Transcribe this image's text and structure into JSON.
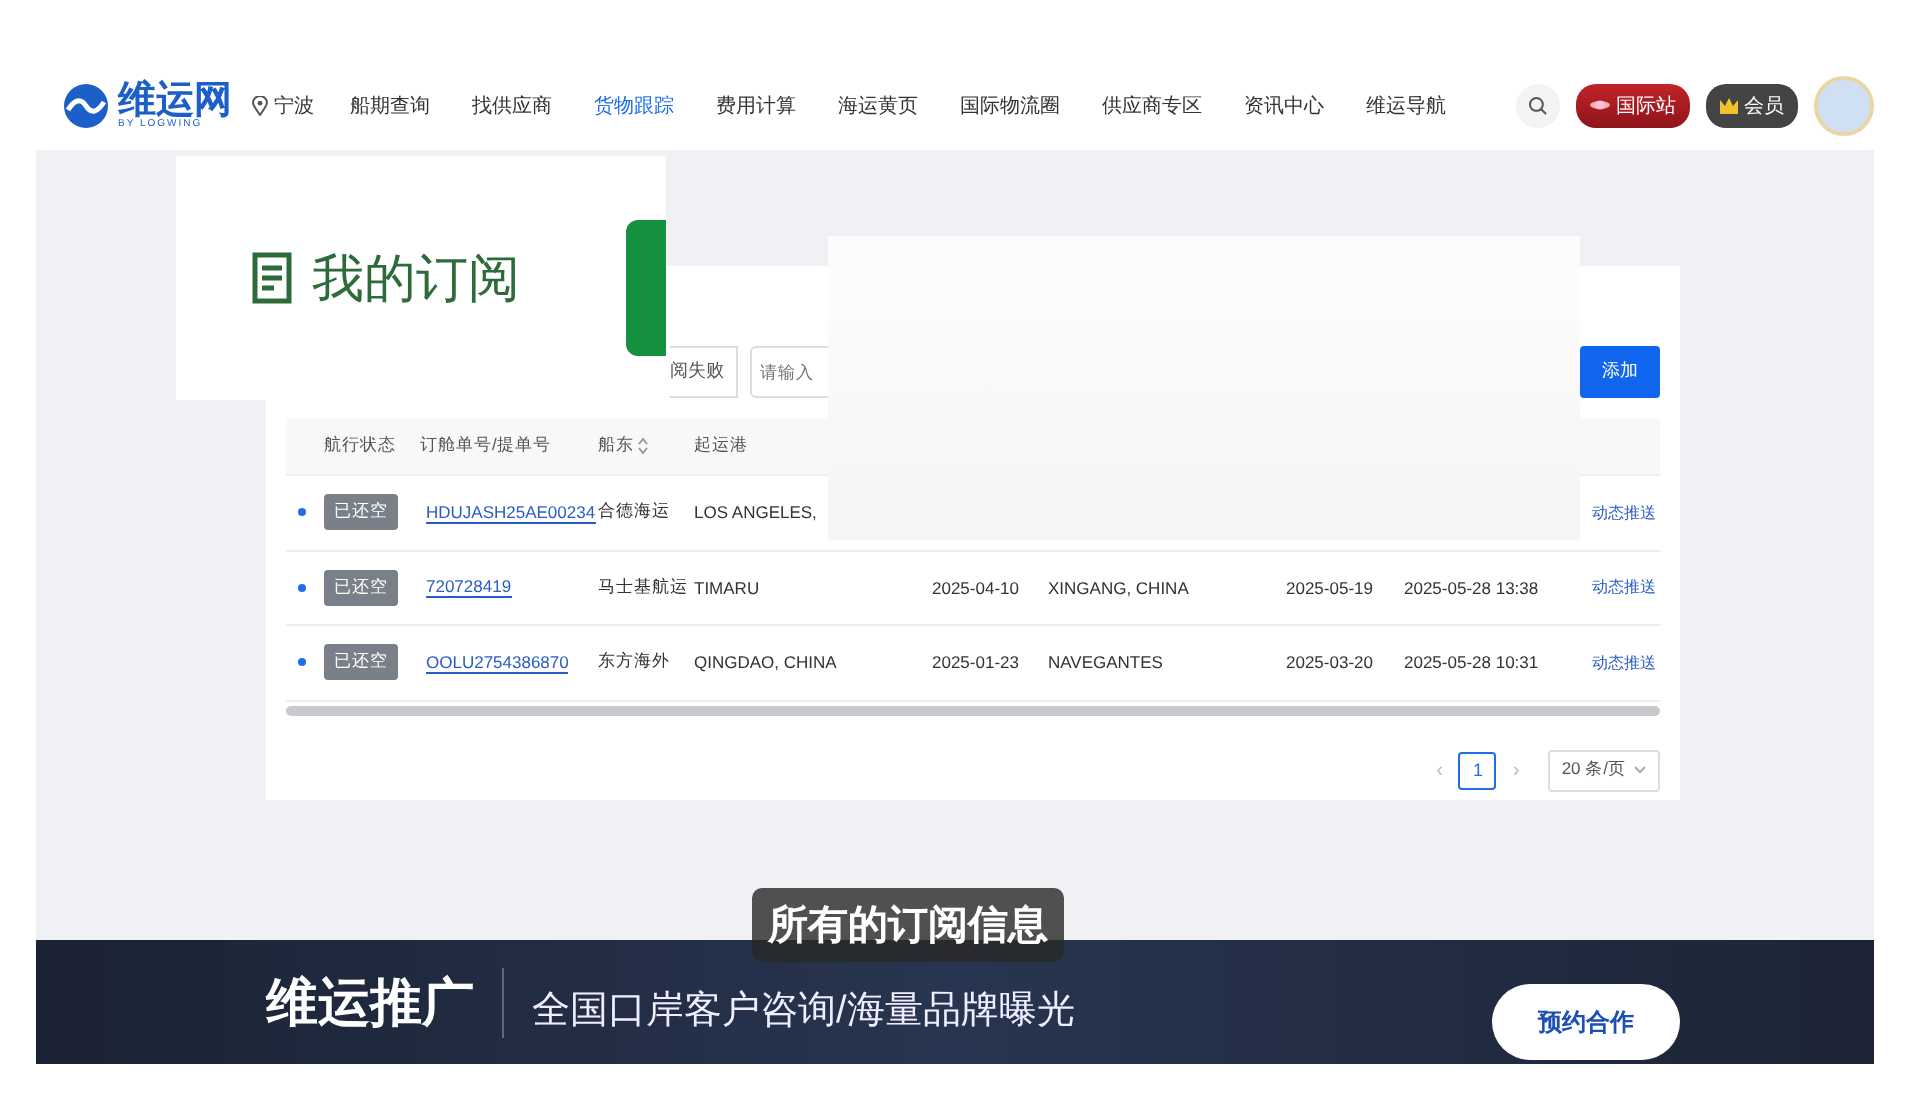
{
  "header": {
    "logo": {
      "name": "维运网",
      "tagline": "BY LOGWING"
    },
    "location": "宁波",
    "nav": [
      {
        "label": "船期查询",
        "selected": false
      },
      {
        "label": "找供应商",
        "selected": false
      },
      {
        "label": "货物跟踪",
        "selected": true
      },
      {
        "label": "费用计算",
        "selected": false
      },
      {
        "label": "海运黄页",
        "selected": false
      },
      {
        "label": "国际物流圈",
        "selected": false
      },
      {
        "label": "供应商专区",
        "selected": false
      },
      {
        "label": "资讯中心",
        "selected": false
      },
      {
        "label": "维运导航",
        "selected": false
      }
    ],
    "intl_button": "国际站",
    "member_button": "会员"
  },
  "callout": {
    "title": "我的订阅"
  },
  "filters": {
    "status_tab": "阅失败",
    "search": {
      "placeholder": "请输入"
    },
    "add_button": "添加"
  },
  "table": {
    "columns": [
      "航行状态",
      "订舱单号/提单号",
      "船东",
      "起运港"
    ],
    "rows": [
      {
        "status": "已还空",
        "number": "HDUJASH25AE00234",
        "carrier": "合德海运",
        "origin": "LOS ANGELES,",
        "action": "动态推送"
      },
      {
        "status": "已还空",
        "number": "720728419",
        "carrier": "马士基航运",
        "origin": "TIMARU",
        "departure": "2025-04-10",
        "destination": "XINGANG, CHINA",
        "arrival": "2025-05-19",
        "updated": "2025-05-28 13:38",
        "action": "动态推送"
      },
      {
        "status": "已还空",
        "number": "OOLU2754386870",
        "carrier": "东方海外",
        "origin": "QINGDAO, CHINA",
        "departure": "2025-01-23",
        "destination": "NAVEGANTES",
        "arrival": "2025-03-20",
        "updated": "2025-05-28 10:31",
        "action": "动态推送"
      }
    ]
  },
  "pagination": {
    "prev": "‹",
    "next": "›",
    "pages": [
      {
        "label": "1",
        "selected": true
      }
    ],
    "page_size": "20 条/页"
  },
  "subtitle": "所有的订阅信息",
  "banner": {
    "title": "维运推广",
    "tagline": "全国口岸客户咨询/海量品牌曝光",
    "button": "预约合作"
  }
}
